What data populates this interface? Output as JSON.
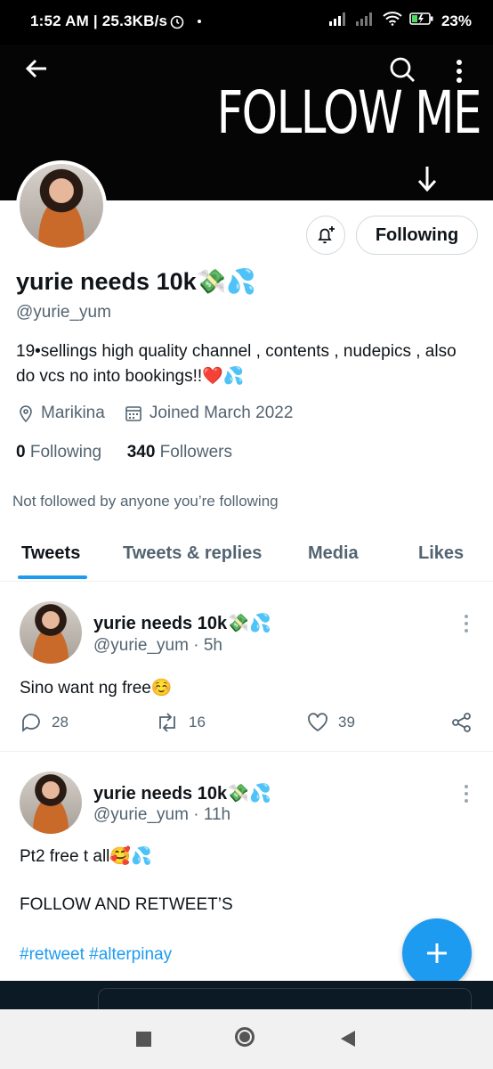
{
  "status_bar": {
    "time": "1:52 AM | 25.3KB/s",
    "battery": "23%"
  },
  "banner": {
    "text": "FOLLOW ME"
  },
  "header": {
    "follow_button": "Following"
  },
  "profile": {
    "name": "yurie needs 10k💸💦",
    "handle": "@yurie_yum",
    "bio": "19•sellings high quality channel , contents , nudepics , also do vcs no into bookings!!❤️💦",
    "location": "Marikina",
    "joined": "Joined March 2022",
    "following_count": "0",
    "following_label": "Following",
    "followers_count": "340",
    "followers_label": "Followers",
    "not_followed_note": "Not followed by anyone you’re following"
  },
  "tabs": [
    {
      "label": "Tweets"
    },
    {
      "label": "Tweets & replies"
    },
    {
      "label": "Media"
    },
    {
      "label": "Likes"
    }
  ],
  "tweets": [
    {
      "name": "yurie needs 10k💸💦",
      "handle_time": "@yurie_yum · 5h",
      "text": "Sino want ng free☺️",
      "replies": "28",
      "retweets": "16",
      "likes": "39"
    },
    {
      "name": "yurie needs 10k💸💦",
      "handle_time": "@yurie_yum · 11h",
      "text_line1": "Pt2 free t all🥰💦",
      "text_line2": "FOLLOW AND RETWEET’S",
      "hashtags": "#retweet #alterpinay"
    }
  ],
  "colors": {
    "accent": "#1d9bf0",
    "text": "#0f1419",
    "secondary": "#536471"
  }
}
